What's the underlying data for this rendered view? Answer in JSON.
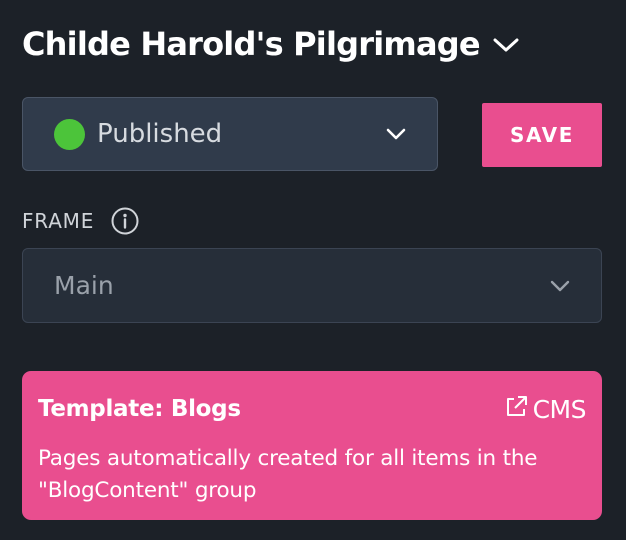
{
  "header": {
    "title": "Childe Harold's Pilgrimage",
    "chevron_icon": "chevron-down-icon"
  },
  "status": {
    "value": "Published",
    "dot_color": "#4cc43a",
    "chevron_icon": "chevron-down-icon"
  },
  "toolbar": {
    "save_label": "SAVE",
    "save_color": "#e94e8f"
  },
  "frame": {
    "label": "FRAME",
    "info_icon": "info-icon",
    "value": "Main",
    "chevron_icon": "chevron-down-icon"
  },
  "template_card": {
    "title": "Template: Blogs",
    "link_label": "CMS",
    "link_icon": "external-link-icon",
    "description": "Pages automatically created for all items in the \"BlogContent\" group",
    "background_color": "#e94e8f"
  },
  "colors": {
    "background": "#1c2128",
    "accent": "#e94e8f",
    "published": "#4cc43a"
  }
}
